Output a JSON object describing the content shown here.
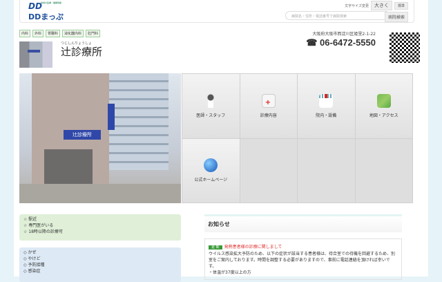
{
  "header": {
    "logo_text": "DDまっぷ",
    "logo_mark": "DD",
    "logo_tagline": "地域の医療・健康情報",
    "font_size_label": "文字サイズ変更",
    "font_large": "大きく",
    "font_standard": "標準",
    "search_placeholder": "病院名・住所・電話番号で病院検索",
    "search_button": "病院検索"
  },
  "clinic": {
    "departments": [
      "内科",
      "外科",
      "胃腸科",
      "消化器内科",
      "肛門科"
    ],
    "name_kana": "つじしんりょうしょ",
    "name": "辻診療所",
    "address": "大阪府大阪市西淀川区姫里2-1-22",
    "phone": "06-6472-5550",
    "phone_icon": "☎",
    "sign_text": "辻診療所"
  },
  "menu": [
    {
      "label": "医師・スタッフ",
      "icon": "doctor-icon"
    },
    {
      "label": "診療内容",
      "icon": "medical-kit-icon"
    },
    {
      "label": "院内・設備",
      "icon": "hospital-icon"
    },
    {
      "label": "地図・アクセス",
      "icon": "map-icon"
    },
    {
      "label": "公式ホームページ",
      "icon": "globe-icon"
    }
  ],
  "features": [
    "☆ 駅近",
    "☆ 専門医がいる",
    "☆ 18時以降の診療可"
  ],
  "symptoms": [
    "◇ かぜ",
    "◇ やけど",
    "◇ 予防接種",
    "◇ 感染症"
  ],
  "notice": {
    "title": "お知らせ",
    "badge": "更 新",
    "headline": "発熱患者様の診療に関しまして",
    "body": "ウイルス感染拡大予防のため、以下の症状が該当する患者様は、待合室での待機を回避するため、別室をご案内しております。時間を調整する必要がありますので、事前に電話連絡を頂ければ幸いです。",
    "bullet": "・体温が37度以上の方"
  }
}
